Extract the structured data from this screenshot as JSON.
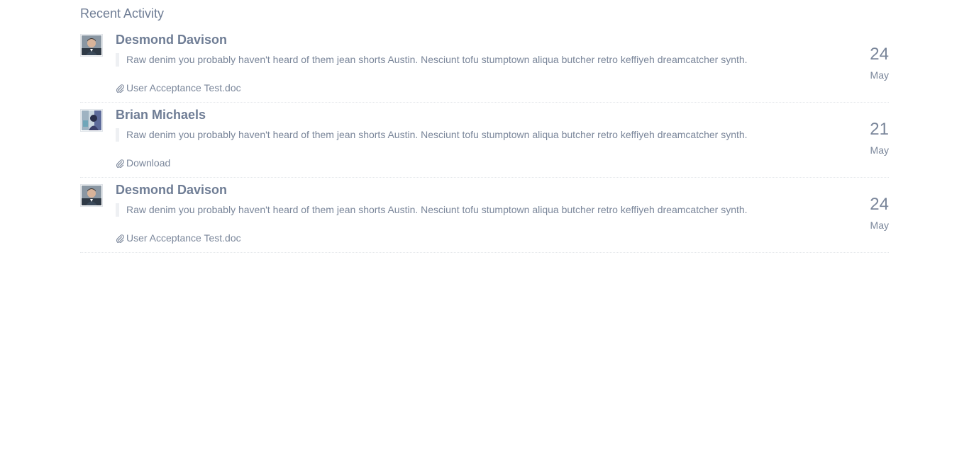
{
  "section": {
    "title": "Recent Activity"
  },
  "activities": [
    {
      "name": "Desmond Davison",
      "avatar_icon": "person-avatar-icon",
      "message": "Raw denim you probably haven't heard of them jean shorts Austin. Nesciunt tofu stumptown aliqua butcher retro keffiyeh dreamcatcher synth.",
      "attachment": "User Acceptance Test.doc",
      "day": "24",
      "month": "May"
    },
    {
      "name": "Brian Michaels",
      "avatar_icon": "person-avatar-icon",
      "message": "Raw denim you probably haven't heard of them jean shorts Austin. Nesciunt tofu stumptown aliqua butcher retro keffiyeh dreamcatcher synth.",
      "attachment": "Download",
      "day": "21",
      "month": "May"
    },
    {
      "name": "Desmond Davison",
      "avatar_icon": "person-avatar-icon",
      "message": "Raw denim you probably haven't heard of them jean shorts Austin. Nesciunt tofu stumptown aliqua butcher retro keffiyeh dreamcatcher synth.",
      "attachment": "User Acceptance Test.doc",
      "day": "24",
      "month": "May"
    }
  ],
  "colors": {
    "text": "#7a869a",
    "heading": "#6f7d95",
    "divider": "#e3e6ea"
  }
}
